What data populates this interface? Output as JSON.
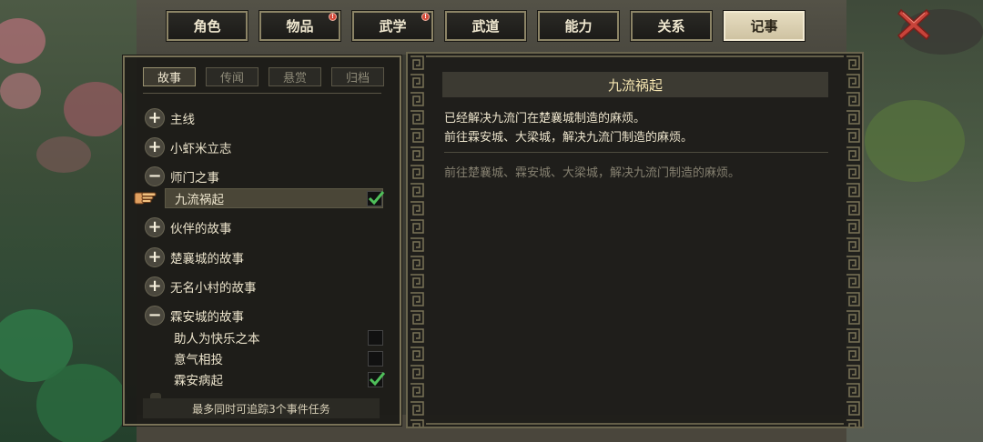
{
  "tabs": [
    {
      "label": "角色",
      "active": false,
      "badge": false
    },
    {
      "label": "物品",
      "active": false,
      "badge": true
    },
    {
      "label": "武学",
      "active": false,
      "badge": true
    },
    {
      "label": "武道",
      "active": false,
      "badge": false
    },
    {
      "label": "能力",
      "active": false,
      "badge": false
    },
    {
      "label": "关系",
      "active": false,
      "badge": false
    },
    {
      "label": "记事",
      "active": true,
      "badge": false
    }
  ],
  "subtabs": [
    {
      "label": "故事",
      "active": true
    },
    {
      "label": "传闻",
      "active": false
    },
    {
      "label": "悬赏",
      "active": false
    },
    {
      "label": "归档",
      "active": false
    }
  ],
  "quests": {
    "main": {
      "label": "主线",
      "expanded": false
    },
    "xiaoxiami": {
      "label": "小虾米立志",
      "expanded": false
    },
    "shimen": {
      "label": "师门之事",
      "expanded": true,
      "children": [
        {
          "label": "九流祸起",
          "checked": true,
          "selected": true
        }
      ]
    },
    "huoban": {
      "label": "伙伴的故事",
      "expanded": false
    },
    "chuxiang": {
      "label": "楚襄城的故事",
      "expanded": false
    },
    "wuming": {
      "label": "无名小村的故事",
      "expanded": false
    },
    "linan": {
      "label": "霖安城的故事",
      "expanded": true,
      "children": [
        {
          "label": "助人为快乐之本",
          "checked": false
        },
        {
          "label": "意气相投",
          "checked": false
        },
        {
          "label": "霖安病起",
          "checked": true
        }
      ]
    }
  },
  "footer_note": "最多同时可追踪3个事件任务",
  "detail": {
    "title": "九流祸起",
    "line1": "已经解决九流门在楚襄城制造的麻烦。",
    "line2": "前往霖安城、大梁城，解决九流门制造的麻烦。",
    "next": "前往楚襄城、霖安城、大梁城，解决九流门制造的麻烦。"
  },
  "icons": {
    "close": "close-x-icon",
    "expand": "plus-icon",
    "collapse": "minus-icon",
    "pointer": "hand-pointer-icon",
    "check": "checkmark-icon"
  },
  "colors": {
    "accent_title": "#f4e4b0",
    "check_green": "#4fbf5a",
    "close_red": "#c8433a"
  }
}
